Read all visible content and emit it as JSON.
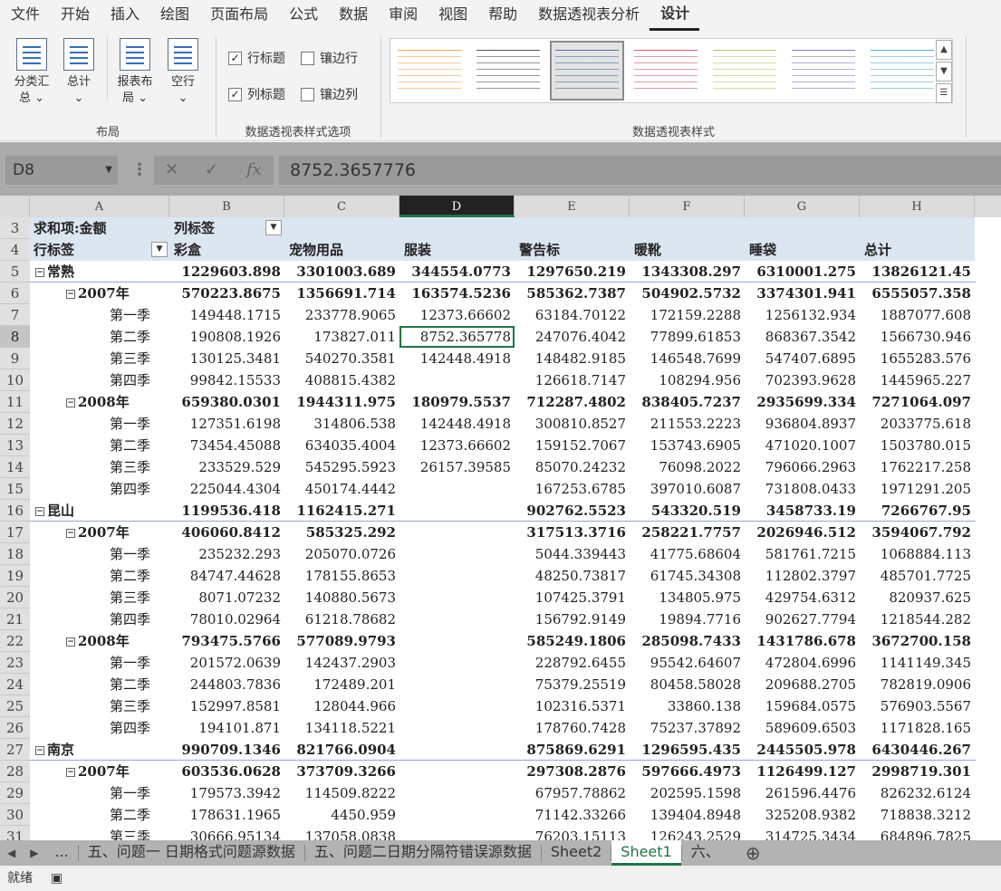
{
  "menu": [
    "文件",
    "开始",
    "插入",
    "绘图",
    "页面布局",
    "公式",
    "数据",
    "审阅",
    "视图",
    "帮助",
    "数据透视表分析",
    "设计"
  ],
  "ribbon": {
    "layout_buttons": [
      {
        "line1": "分类汇",
        "line2": "总 ⌄"
      },
      {
        "line1": "总计",
        "line2": "⌄"
      },
      {
        "line1": "报表布",
        "line2": "局 ⌄"
      },
      {
        "line1": "空行",
        "line2": "⌄"
      }
    ],
    "layout_group": "布局",
    "options": {
      "row_headers": "行标题",
      "banded_rows": "镶边行",
      "col_headers": "列标题",
      "banded_cols": "镶边列"
    },
    "options_group": "数据透视表样式选项",
    "styles_group": "数据透视表样式"
  },
  "formula_bar": {
    "name_box": "D8",
    "formula": "8752.3657776",
    "fx": "fx"
  },
  "columns": [
    "A",
    "B",
    "C",
    "D",
    "E",
    "F",
    "G",
    "H"
  ],
  "rows": [
    {
      "n": "3",
      "type": "h1",
      "a": "求和项:金额",
      "b": "列标签",
      "c": "",
      "d": "",
      "e": "",
      "f": "",
      "g": "",
      "h": ""
    },
    {
      "n": "4",
      "type": "h2",
      "a": "行标签",
      "b": "彩盒",
      "c": "宠物用品",
      "d": "服装",
      "e": "警告标",
      "f": "暖靴",
      "g": "睡袋",
      "h": "总计"
    },
    {
      "n": "5",
      "type": "l1",
      "a": "常熟",
      "b": "1229603.898",
      "c": "3301003.689",
      "d": "344554.0773",
      "e": "1297650.219",
      "f": "1343308.297",
      "g": "6310001.275",
      "h": "13826121.45"
    },
    {
      "n": "6",
      "type": "l2",
      "a": "2007年",
      "b": "570223.8675",
      "c": "1356691.714",
      "d": "163574.5236",
      "e": "585362.7387",
      "f": "504902.5732",
      "g": "3374301.941",
      "h": "6555057.358"
    },
    {
      "n": "7",
      "type": "l3",
      "a": "第一季",
      "b": "149448.1715",
      "c": "233778.9065",
      "d": "12373.66602",
      "e": "63184.70122",
      "f": "172159.2288",
      "g": "1256132.934",
      "h": "1887077.608"
    },
    {
      "n": "8",
      "type": "l3",
      "a": "第二季",
      "b": "190808.1926",
      "c": "173827.011",
      "d": "8752.365778",
      "e": "247076.4042",
      "f": "77899.61853",
      "g": "868367.3542",
      "h": "1566730.946"
    },
    {
      "n": "9",
      "type": "l3",
      "a": "第三季",
      "b": "130125.3481",
      "c": "540270.3581",
      "d": "142448.4918",
      "e": "148482.9185",
      "f": "146548.7699",
      "g": "547407.6895",
      "h": "1655283.576"
    },
    {
      "n": "10",
      "type": "l3",
      "a": "第四季",
      "b": "99842.15533",
      "c": "408815.4382",
      "d": "",
      "e": "126618.7147",
      "f": "108294.956",
      "g": "702393.9628",
      "h": "1445965.227"
    },
    {
      "n": "11",
      "type": "l2",
      "a": "2008年",
      "b": "659380.0301",
      "c": "1944311.975",
      "d": "180979.5537",
      "e": "712287.4802",
      "f": "838405.7237",
      "g": "2935699.334",
      "h": "7271064.097"
    },
    {
      "n": "12",
      "type": "l3",
      "a": "第一季",
      "b": "127351.6198",
      "c": "314806.538",
      "d": "142448.4918",
      "e": "300810.8527",
      "f": "211553.2223",
      "g": "936804.8937",
      "h": "2033775.618"
    },
    {
      "n": "13",
      "type": "l3",
      "a": "第二季",
      "b": "73454.45088",
      "c": "634035.4004",
      "d": "12373.66602",
      "e": "159152.7067",
      "f": "153743.6905",
      "g": "471020.1007",
      "h": "1503780.015"
    },
    {
      "n": "14",
      "type": "l3",
      "a": "第三季",
      "b": "233529.529",
      "c": "545295.5923",
      "d": "26157.39585",
      "e": "85070.24232",
      "f": "76098.2022",
      "g": "796066.2963",
      "h": "1762217.258"
    },
    {
      "n": "15",
      "type": "l3",
      "a": "第四季",
      "b": "225044.4304",
      "c": "450174.4442",
      "d": "",
      "e": "167253.6785",
      "f": "397010.6087",
      "g": "731808.0433",
      "h": "1971291.205"
    },
    {
      "n": "16",
      "type": "l1",
      "a": "昆山",
      "b": "1199536.418",
      "c": "1162415.271",
      "d": "",
      "e": "902762.5523",
      "f": "543320.519",
      "g": "3458733.19",
      "h": "7266767.95"
    },
    {
      "n": "17",
      "type": "l2",
      "a": "2007年",
      "b": "406060.8412",
      "c": "585325.292",
      "d": "",
      "e": "317513.3716",
      "f": "258221.7757",
      "g": "2026946.512",
      "h": "3594067.792"
    },
    {
      "n": "18",
      "type": "l3",
      "a": "第一季",
      "b": "235232.293",
      "c": "205070.0726",
      "d": "",
      "e": "5044.339443",
      "f": "41775.68604",
      "g": "581761.7215",
      "h": "1068884.113"
    },
    {
      "n": "19",
      "type": "l3",
      "a": "第二季",
      "b": "84747.44628",
      "c": "178155.8653",
      "d": "",
      "e": "48250.73817",
      "f": "61745.34308",
      "g": "112802.3797",
      "h": "485701.7725"
    },
    {
      "n": "20",
      "type": "l3",
      "a": "第三季",
      "b": "8071.07232",
      "c": "140880.5673",
      "d": "",
      "e": "107425.3791",
      "f": "134805.975",
      "g": "429754.6312",
      "h": "820937.625"
    },
    {
      "n": "21",
      "type": "l3",
      "a": "第四季",
      "b": "78010.02964",
      "c": "61218.78682",
      "d": "",
      "e": "156792.9149",
      "f": "19894.7716",
      "g": "902627.7794",
      "h": "1218544.282"
    },
    {
      "n": "22",
      "type": "l2",
      "a": "2008年",
      "b": "793475.5766",
      "c": "577089.9793",
      "d": "",
      "e": "585249.1806",
      "f": "285098.7433",
      "g": "1431786.678",
      "h": "3672700.158"
    },
    {
      "n": "23",
      "type": "l3",
      "a": "第一季",
      "b": "201572.0639",
      "c": "142437.2903",
      "d": "",
      "e": "228792.6455",
      "f": "95542.64607",
      "g": "472804.6996",
      "h": "1141149.345"
    },
    {
      "n": "24",
      "type": "l3",
      "a": "第二季",
      "b": "244803.7836",
      "c": "172489.201",
      "d": "",
      "e": "75379.25519",
      "f": "80458.58028",
      "g": "209688.2705",
      "h": "782819.0906"
    },
    {
      "n": "25",
      "type": "l3",
      "a": "第三季",
      "b": "152997.8581",
      "c": "128044.966",
      "d": "",
      "e": "102316.5371",
      "f": "33860.138",
      "g": "159684.0575",
      "h": "576903.5567"
    },
    {
      "n": "26",
      "type": "l3",
      "a": "第四季",
      "b": "194101.871",
      "c": "134118.5221",
      "d": "",
      "e": "178760.7428",
      "f": "75237.37892",
      "g": "589609.6503",
      "h": "1171828.165"
    },
    {
      "n": "27",
      "type": "l1",
      "a": "南京",
      "b": "990709.1346",
      "c": "821766.0904",
      "d": "",
      "e": "875869.6291",
      "f": "1296595.435",
      "g": "2445505.978",
      "h": "6430446.267"
    },
    {
      "n": "28",
      "type": "l2",
      "a": "2007年",
      "b": "603536.0628",
      "c": "373709.3266",
      "d": "",
      "e": "297308.2876",
      "f": "597666.4973",
      "g": "1126499.127",
      "h": "2998719.301"
    },
    {
      "n": "29",
      "type": "l3",
      "a": "第一季",
      "b": "179573.3942",
      "c": "114509.8222",
      "d": "",
      "e": "67957.78862",
      "f": "202595.1598",
      "g": "261596.4476",
      "h": "826232.6124"
    },
    {
      "n": "30",
      "type": "l3",
      "a": "第二季",
      "b": "178631.1965",
      "c": "4450.959",
      "d": "",
      "e": "71142.33266",
      "f": "139404.8948",
      "g": "325208.9382",
      "h": "718838.3212"
    },
    {
      "n": "31",
      "type": "l3",
      "a": "第三季",
      "b": "30666.95134",
      "c": "137058.0838",
      "d": "",
      "e": "76203.15113",
      "f": "126243.2529",
      "g": "314725.3434",
      "h": "684896.7825"
    }
  ],
  "tabs": [
    "...",
    "五、问题一 日期格式问题源数据",
    "五、问题二日期分隔符错误源数据",
    "Sheet2",
    "Sheet1",
    "六、"
  ],
  "active_tab": "Sheet1",
  "status": "就绪",
  "colors": {
    "accent": "#217346",
    "header_band": "#dce6f1"
  }
}
